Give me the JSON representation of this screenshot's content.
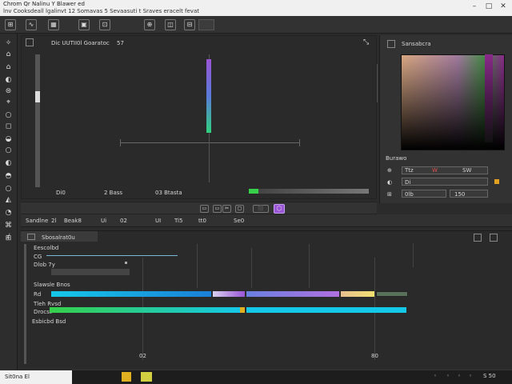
{
  "titlebar": {
    "title": "Chrom Qr  Nalinu  Y  Blawer ed",
    "menu": "lnv   Cooksdeall lgalinvt 12 Somavas 5 Sevaasuti  t Sraves eracelt fevat",
    "min": "–",
    "max": "□",
    "close": "✕"
  },
  "toolbar": {
    "buttons": [
      "⊞",
      "∿",
      "▦",
      "▣",
      "⊡",
      "⊕",
      "◫",
      "⊟"
    ]
  },
  "left_tools": [
    "✧",
    "⌂",
    "⌂",
    "◐",
    "⊜",
    "⌖",
    "○",
    "◻",
    "◒",
    "○",
    "◐",
    "◓",
    "○",
    "◭",
    "◔",
    "⌘",
    "⌿",
    "⊞"
  ],
  "viewport": {
    "head_label": "Dic  UUTII0l  Goaratoc",
    "head_num": "57",
    "corner_icon": "⤡",
    "bottom_labels": [
      "Di0",
      "2 Bass",
      "03 Btasta"
    ]
  },
  "right_panel": {
    "title": "Sansabcra",
    "fields": [
      {
        "icon": "⊕",
        "value": "Ttz"
      },
      {
        "icon": "◐",
        "value": "Di"
      },
      {
        "icon": "⊞",
        "value": "0lb"
      }
    ],
    "tag1": "W",
    "tag2": "SW",
    "field3_end": "150",
    "label_mid": "Burawo"
  },
  "midbar": {
    "buttons": [
      "▭",
      "▭",
      "✂",
      "▢",
      "⬛",
      "⬡"
    ]
  },
  "status": {
    "items": [
      "Sandlne",
      "2l",
      "Beak8",
      "Ui",
      "02",
      "UI",
      "Ti5",
      "tt0",
      "Se0"
    ]
  },
  "timeline": {
    "header": "Sbosalrat0u",
    "tracks": [
      "Eescolbd",
      "CG",
      "Dlob 7y",
      "Slawsle Bnos",
      "Rd",
      "Tleh Rvsd",
      "Drocst",
      "Esbicbd Bsd"
    ],
    "marker_left": "02",
    "marker_right": "80"
  },
  "taskbar": {
    "start": "Sit0na  El",
    "time": "S  50"
  },
  "colors": {
    "accent": "#9a55d6",
    "cyan": "#15c8e8",
    "green": "#36d04a"
  }
}
